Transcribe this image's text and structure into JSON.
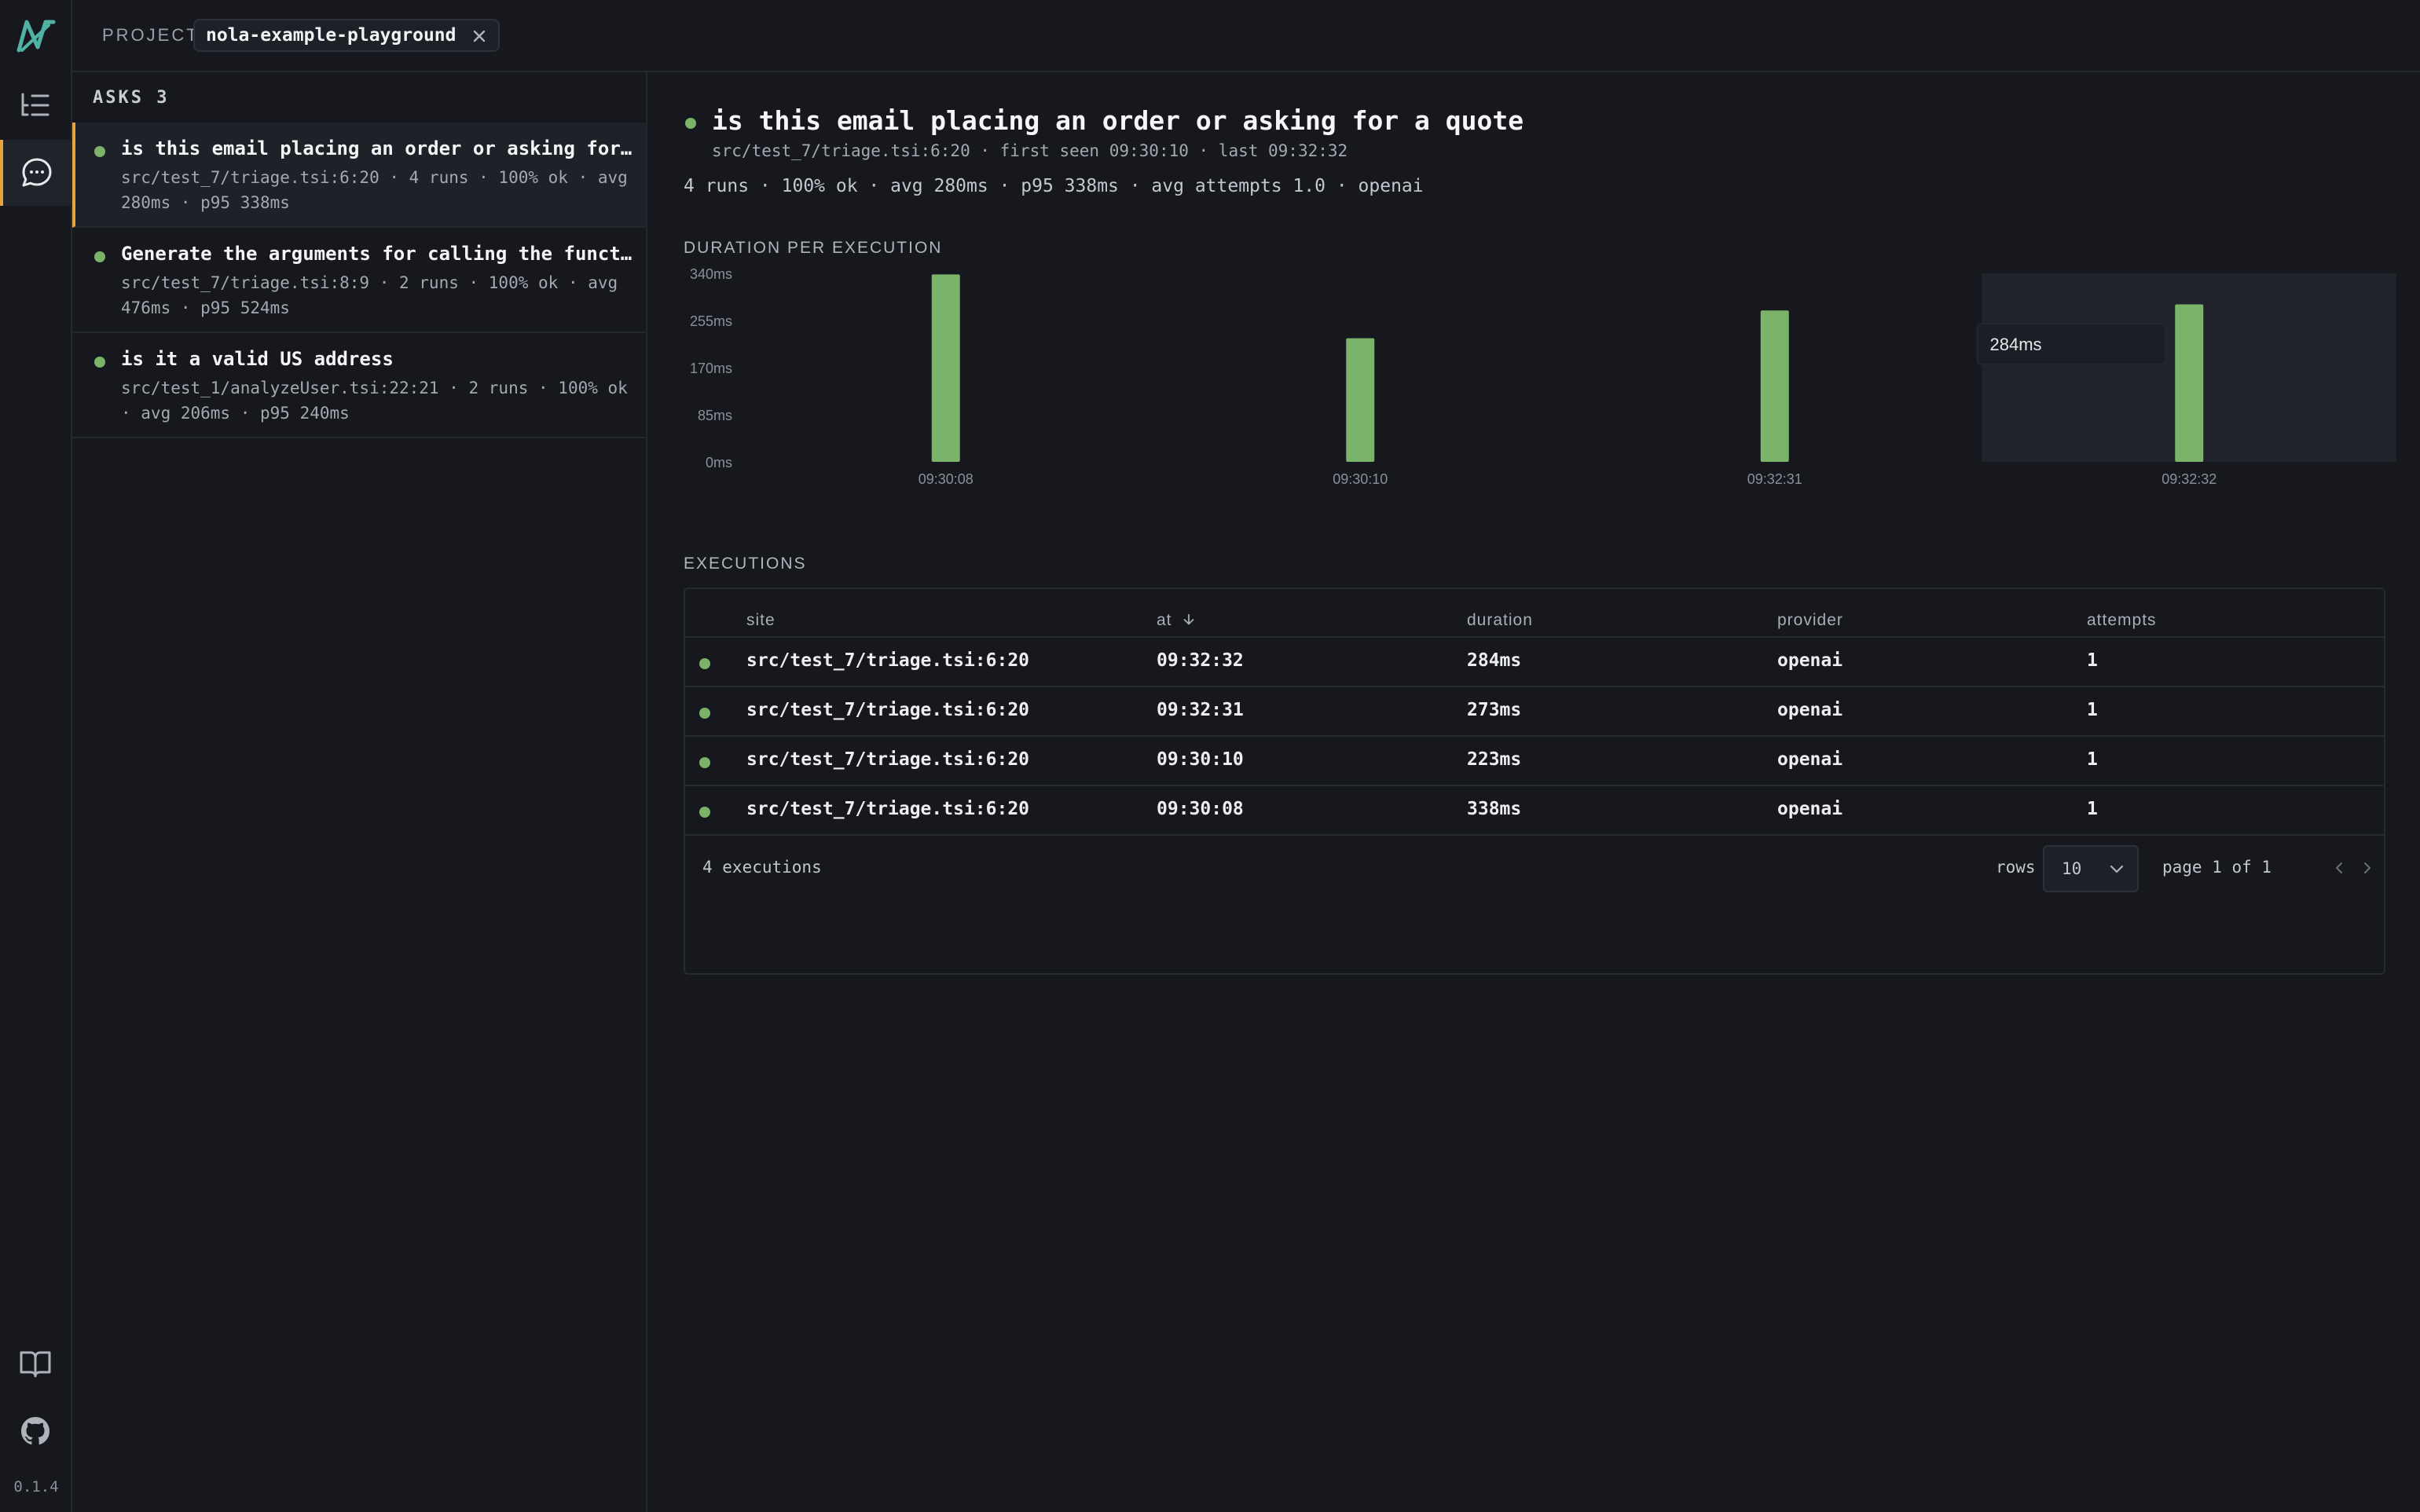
{
  "app": {
    "version": "0.1.4",
    "icons": {
      "logo": "nola-logo",
      "asks_nav": "list-icon",
      "chat_nav": "chat-bubble-icon",
      "docs_nav": "book-icon",
      "github_nav": "github-icon"
    },
    "accent_color": "#e8a33d",
    "ok_color": "#7cb36a"
  },
  "project": {
    "label": "PROJECT",
    "name": "nola-example-playground"
  },
  "asks": {
    "header": "ASKS 3",
    "items": [
      {
        "title": "is this email placing an order or asking for a quote",
        "meta": "src/test_7/triage.tsi:6:20 · 4 runs · 100% ok · avg 280ms · p95 338ms",
        "status": "ok",
        "active": true
      },
      {
        "title": "Generate the arguments for calling the function",
        "meta": "src/test_7/triage.tsi:8:9 · 2 runs · 100% ok · avg 476ms · p95 524ms",
        "status": "ok",
        "active": false
      },
      {
        "title": "is it a valid US address",
        "meta": "src/test_1/analyzeUser.tsi:22:21 · 2 runs · 100% ok · avg 206ms · p95 240ms",
        "status": "ok",
        "active": false
      }
    ]
  },
  "detail": {
    "title": "is this email placing an order or asking for a quote",
    "subtitle": "src/test_7/triage.tsi:6:20 · first seen 09:30:10 · last 09:32:32",
    "stats": "4 runs · 100% ok · avg 280ms · p95 338ms · avg attempts 1.0 · openai",
    "duration_label": "DURATION PER EXECUTION",
    "executions_label": "EXECUTIONS"
  },
  "chart_data": {
    "type": "bar",
    "categories": [
      "09:30:08",
      "09:30:10",
      "09:32:31",
      "09:32:32"
    ],
    "values": [
      338,
      223,
      273,
      284
    ],
    "y_ticks": [
      "340ms",
      "255ms",
      "170ms",
      "85ms",
      "0ms"
    ],
    "ylim": [
      0,
      340
    ],
    "unit": "ms",
    "hovered_index": 3,
    "tooltip": "284ms",
    "bar_color": "#7cb36a",
    "title": "",
    "xlabel": "",
    "ylabel": ""
  },
  "table": {
    "columns": {
      "site": "site",
      "at": "at",
      "duration": "duration",
      "provider": "provider",
      "attempts": "attempts"
    },
    "sort_icon": "arrow-down-icon",
    "rows": [
      {
        "site": "src/test_7/triage.tsi:6:20",
        "at": "09:32:32",
        "duration": "284ms",
        "provider": "openai",
        "attempts": "1"
      },
      {
        "site": "src/test_7/triage.tsi:6:20",
        "at": "09:32:31",
        "duration": "273ms",
        "provider": "openai",
        "attempts": "1"
      },
      {
        "site": "src/test_7/triage.tsi:6:20",
        "at": "09:30:10",
        "duration": "223ms",
        "provider": "openai",
        "attempts": "1"
      },
      {
        "site": "src/test_7/triage.tsi:6:20",
        "at": "09:30:08",
        "duration": "338ms",
        "provider": "openai",
        "attempts": "1"
      }
    ],
    "footer": {
      "count": "4 executions",
      "rows_label": "rows",
      "rows_value": "10",
      "page": "page 1 of 1"
    }
  }
}
